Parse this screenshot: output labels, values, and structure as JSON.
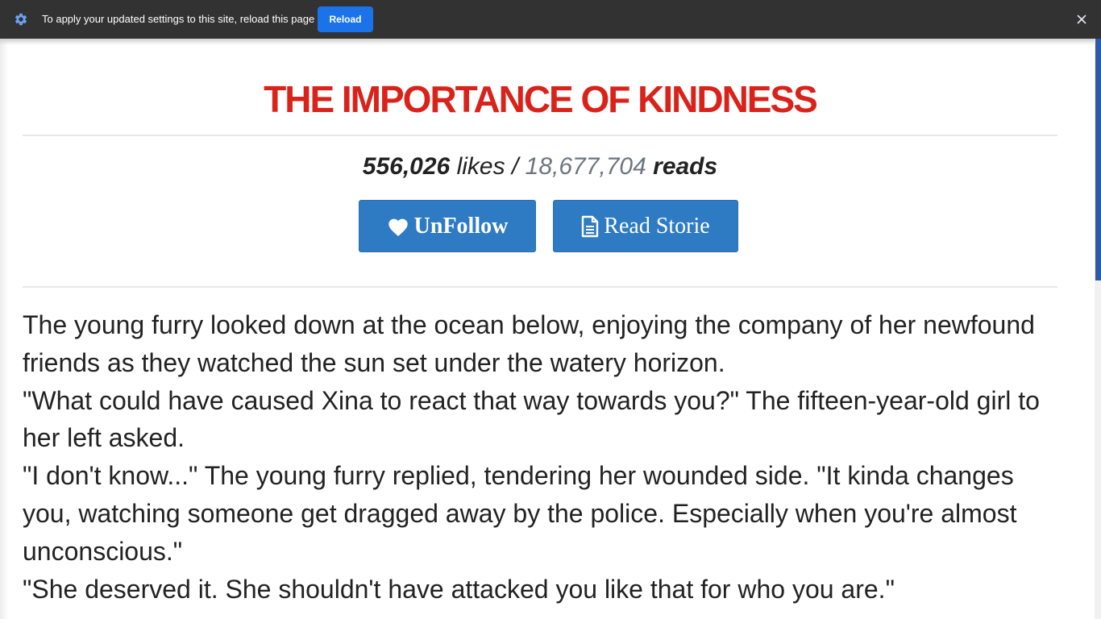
{
  "infobar": {
    "message": "To apply your updated settings to this site, reload this page",
    "reload_label": "Reload",
    "icons": {
      "settings": "gear-icon",
      "close": "close-icon"
    }
  },
  "story": {
    "title": "THE IMPORTANCE OF KINDNESS",
    "likes_count": "556,026",
    "likes_label": "likes",
    "separator": "/",
    "reads_count": "18,677,704",
    "reads_label": "reads",
    "follow_button_label": "UnFollow",
    "read_button_label": "Read Storie",
    "paragraphs": [
      "The young furry looked down at the ocean below, enjoying the company of her newfound friends as they watched the sun set under the watery horizon.",
      "\"What could have caused Xina to react that way towards you?\" The fifteen-year-old girl to her left asked.",
      "\"I don't know...\" The young furry replied, tendering her wounded side. \"It kinda changes you, watching someone get dragged away by the police. Especially when you're almost unconscious.\"",
      "\"She deserved it. She shouldn't have attacked you like that for who you are.\""
    ]
  },
  "colors": {
    "title": "#d9231a",
    "button": "#2e7bc4",
    "infobar": "#323232",
    "reload_button": "#1a73e8",
    "reads_count": "#6c7680"
  }
}
